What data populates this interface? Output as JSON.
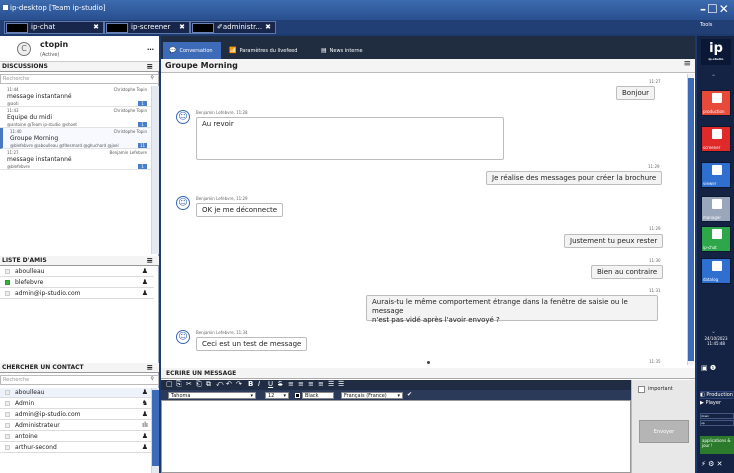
{
  "window": {
    "title": "ip-desktop [Team ip-studio]",
    "tabs": [
      {
        "label": "ip-chat",
        "close": "✖"
      },
      {
        "label": "ip-screener",
        "close": "✖"
      },
      {
        "label": "✐administr...",
        "close": "✖"
      }
    ],
    "controls": "–☐✕",
    "tools_label": "Tools"
  },
  "user": {
    "initial": "C",
    "name": "ctopin",
    "status": "(Active)",
    "menu": "…"
  },
  "discussions": {
    "heading": "DISCUSSIONS",
    "search_placeholder": "Recherche",
    "items": [
      {
        "time": "11:44",
        "author": "Christophe Topin",
        "title": "message instantanné",
        "tags": "@aoti",
        "count": "1",
        "active": false
      },
      {
        "time": "11:43",
        "author": "Christophe Topin",
        "title": "Equipe du midi",
        "tags": "@antoine @Team ip-studio @shoet",
        "count": "1",
        "active": false
      },
      {
        "time": "11:40",
        "author": "Christophe Topin",
        "title": "Groupe Morning",
        "tags": "@blefebvre @aboulleau @fdesmard @ghuchard @joel",
        "count": "11",
        "active": true
      },
      {
        "time": "11:27",
        "author": "Benjamin Lefebvre",
        "title": "message instantanné",
        "tags": "@blefebvre",
        "count": "1",
        "active": false
      }
    ]
  },
  "friends": {
    "heading": "LISTE D'AMIS",
    "items": [
      {
        "name": "aboulleau",
        "online": false,
        "icon": "♟"
      },
      {
        "name": "blefebvre",
        "online": true,
        "icon": "♟"
      },
      {
        "name": "admin@ip-studio.com",
        "online": false,
        "icon": "♟"
      }
    ]
  },
  "contacts": {
    "heading": "CHERCHER UN CONTACT",
    "search_placeholder": "Recherche",
    "items": [
      {
        "name": "aboulleau",
        "icon": "♟"
      },
      {
        "name": "Admin",
        "icon": "♞"
      },
      {
        "name": "admin@ip-studio.com",
        "icon": "♟"
      },
      {
        "name": "Administrateur",
        "icon": "ılı"
      },
      {
        "name": "antoine",
        "icon": "♟"
      },
      {
        "name": "arthur-second",
        "icon": "♟"
      }
    ]
  },
  "chat_tabs": [
    {
      "icon": "💬",
      "label": "Conversation",
      "active": true
    },
    {
      "icon": "📶",
      "label": "Paramètres du livefeed",
      "active": false
    },
    {
      "icon": "▤",
      "label": "News interne",
      "active": false
    }
  ],
  "conversation": {
    "title": "Groupe Morning",
    "menu": "≡",
    "messages": [
      {
        "side": "right",
        "time": "11:27",
        "text": "Bonjour"
      },
      {
        "side": "left",
        "meta": "Benjamin Lefebvre, 11:28",
        "text": "Au revoir"
      },
      {
        "side": "right",
        "time": "11:29",
        "text": "Je réalise des messages pour créer la brochure"
      },
      {
        "side": "left",
        "meta": "Benjamin Lefebvre, 11:29",
        "text": "OK je me déconnecte"
      },
      {
        "side": "right",
        "time": "11:29",
        "text": "Justement tu peux rester"
      },
      {
        "side": "right",
        "time": "11:30",
        "text": "Bien au contraire"
      },
      {
        "side": "right",
        "time": "11:31",
        "text": "Aurais-tu le même comportement étrange dans la fenêtre de saisie ou le message",
        "text2": "n'est pas vidé après l'avoir envoyé ?"
      },
      {
        "side": "left",
        "meta": "Benjamin Lefebvre, 11:34",
        "text": "Ceci est un test de message"
      },
      {
        "side": "right",
        "time": "11:35",
        "text": ""
      }
    ]
  },
  "compose": {
    "title": "ECRIRE UN MESSAGE",
    "toolbar_glyphs": [
      "▢",
      "⎘",
      "✂",
      "⎗",
      "⧉",
      "⤺",
      "↶",
      "↷",
      "B",
      "I",
      "U",
      "S",
      "≡",
      "≡",
      "≡",
      "≡",
      "☰",
      "☰"
    ],
    "font": "Tahoma",
    "size": "12",
    "color_label": "Black",
    "language": "Français (France)",
    "spell": "✔",
    "important_label": "important",
    "send_label": "Envoyer"
  },
  "sidebar": {
    "logo": "ip",
    "logo_sub": "ip-studio",
    "chev_up": "⌃",
    "chev_down": "⌄",
    "buttons": [
      {
        "label": "production",
        "color": "#e84a3a"
      },
      {
        "label": "screener",
        "color": "#e02a2a"
      },
      {
        "label": "viewer",
        "color": "#2f6fd0"
      },
      {
        "label": "manager",
        "color": "#9aa6bc"
      },
      {
        "label": "ip-chat",
        "color": "#2ea64a"
      },
      {
        "label": "datalog",
        "color": "#2f6fd0"
      }
    ],
    "date": "24/10/2023",
    "time": "11:45:48",
    "clock_icons": "▣ ❶",
    "production_label": "Production",
    "player_label": "Player",
    "down_label": "down",
    "up_label": "up",
    "apps_label": "applications & jour !",
    "bottom_icons": "⚡ ⚙ ✕"
  },
  "colors": {
    "accent": "#3e6bb7",
    "titlebar": "#294f8f",
    "chat_bar": "#202c3f"
  }
}
